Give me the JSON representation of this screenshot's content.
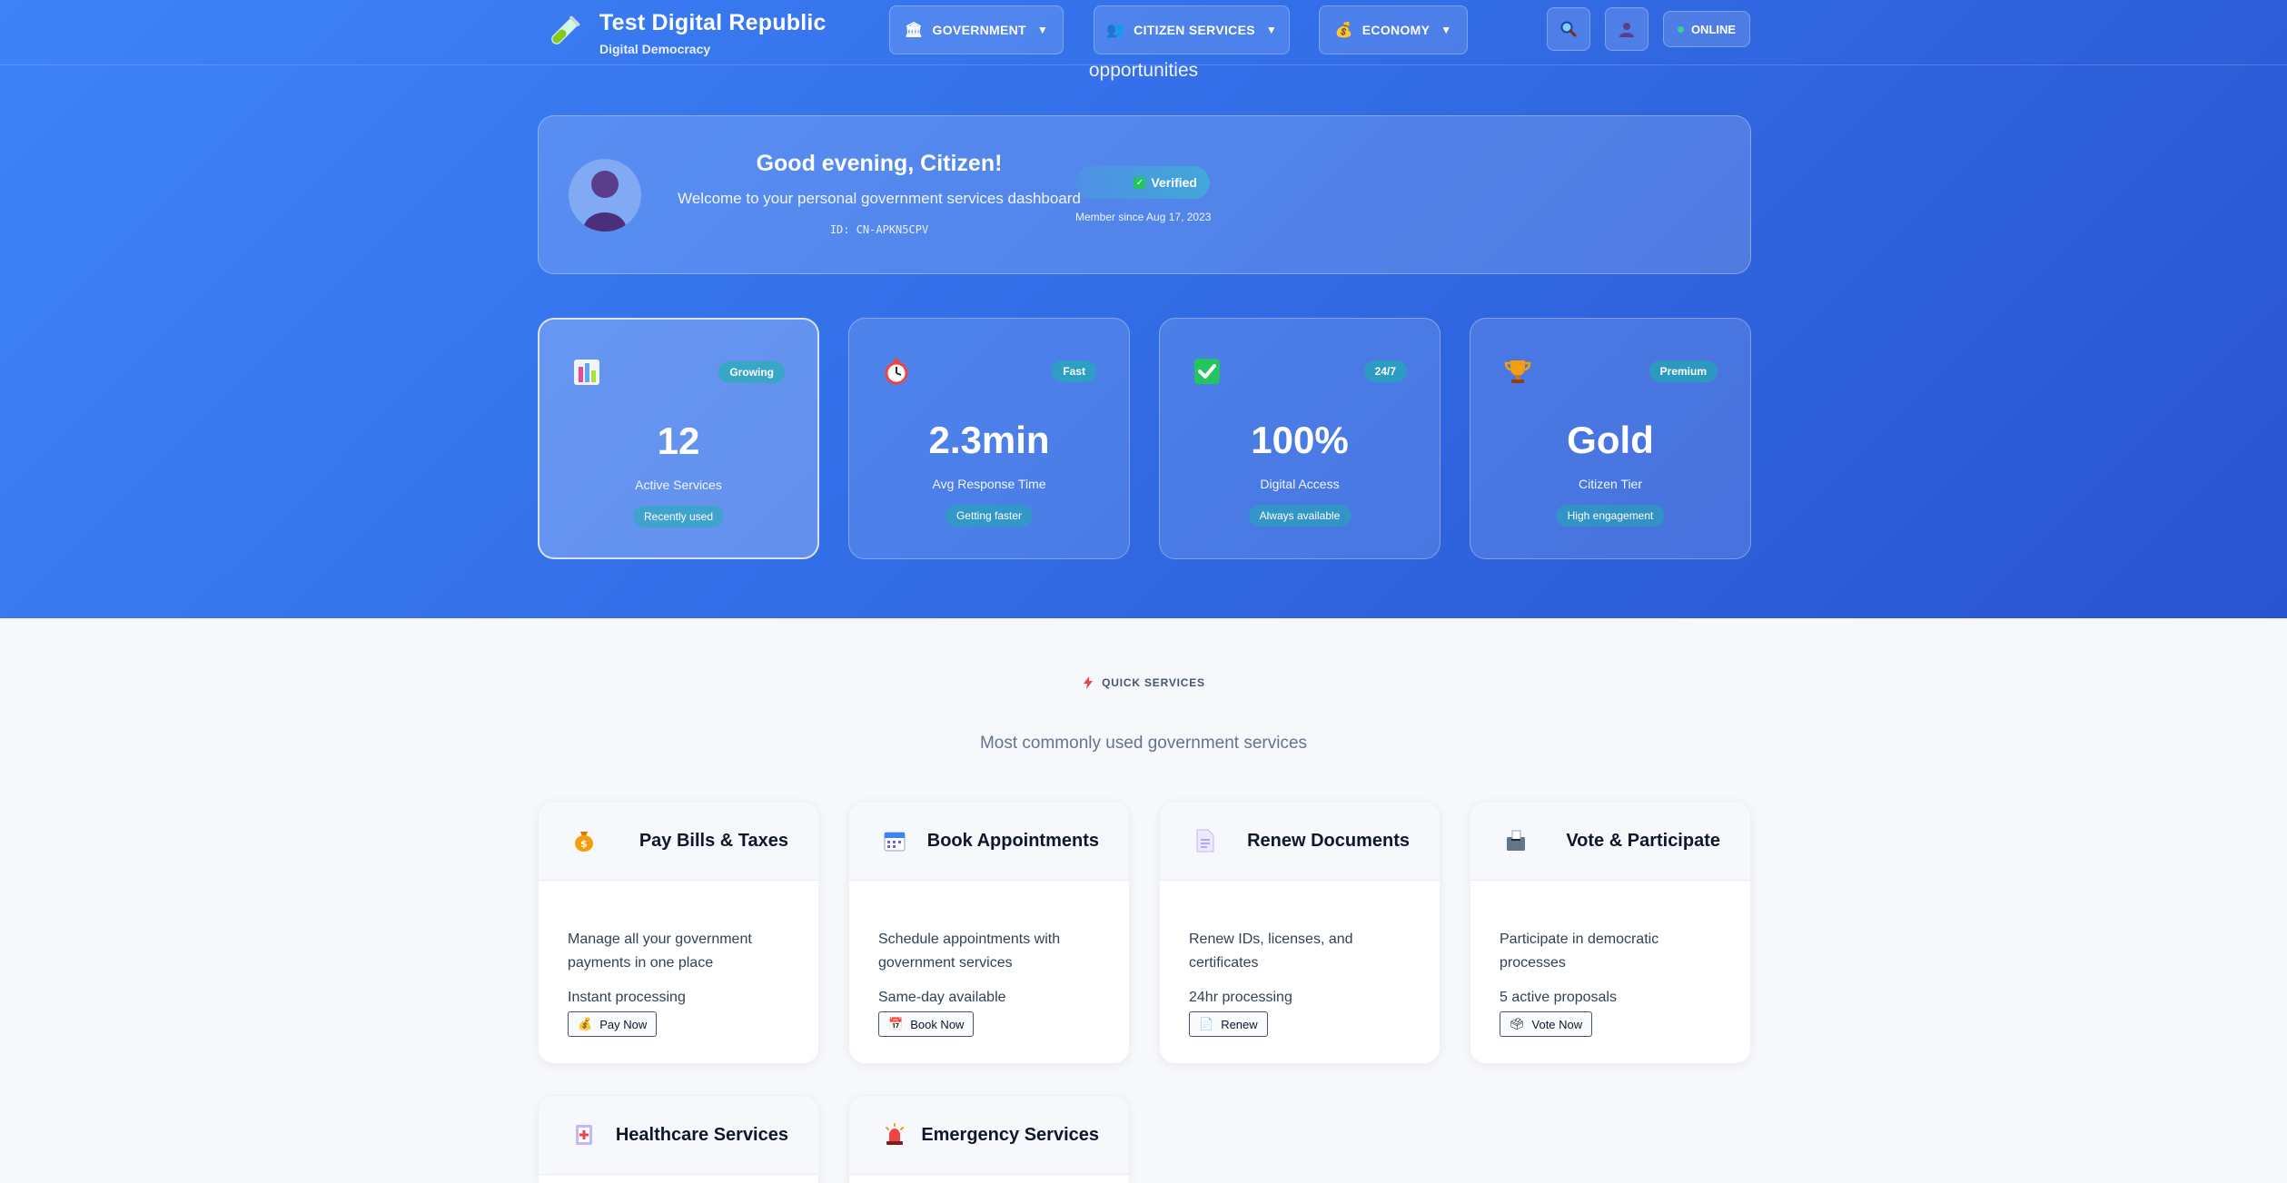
{
  "brand": {
    "title": "Test Digital Republic",
    "subtitle": "Digital Democracy",
    "icon": "test-tube-icon"
  },
  "nav": [
    {
      "label": "GOVERNMENT",
      "icon": "classical-building-icon"
    },
    {
      "label": "CITIZEN SERVICES",
      "icon": "people-icon"
    },
    {
      "label": "ECONOMY",
      "icon": "money-bag-icon"
    }
  ],
  "nav_icons": [
    "search-icon",
    "user-icon"
  ],
  "status": {
    "label": "ONLINE",
    "color": "#34d399"
  },
  "hero_cut_text": "opportunities",
  "welcome": {
    "greeting": "Good evening, Citizen!",
    "subtitle": "Welcome to your personal government services dashboard",
    "citizen_id": "ID: CN-APKN5CPV",
    "verified": "Verified",
    "member_since": "Member since Aug 17, 2023"
  },
  "stats": [
    {
      "icon": "bar-chart-icon",
      "badge": "Growing",
      "value": "12",
      "label": "Active Services",
      "footer": "Recently used",
      "active": true
    },
    {
      "icon": "stopwatch-icon",
      "badge": "Fast",
      "value": "2.3min",
      "label": "Avg Response Time",
      "footer": "Getting faster",
      "active": false
    },
    {
      "icon": "check-mark-icon",
      "badge": "24/7",
      "value": "100%",
      "label": "Digital Access",
      "footer": "Always available",
      "active": false
    },
    {
      "icon": "trophy-icon",
      "badge": "Premium",
      "value": "Gold",
      "label": "Citizen Tier",
      "footer": "High engagement",
      "active": false
    }
  ],
  "quick_services": {
    "heading": "QUICK SERVICES",
    "heading_icon": "lightning-icon",
    "subtitle": "Most commonly used government services",
    "cards": [
      {
        "title": "Pay Bills & Taxes",
        "icon": "money-bag-icon",
        "description": "Manage all your government payments in one place",
        "meta": "Instant processing",
        "button": "Pay Now"
      },
      {
        "title": "Book Appointments",
        "icon": "calendar-icon",
        "description": "Schedule appointments with government services",
        "meta": "Same-day available",
        "button": "Book Now"
      },
      {
        "title": "Renew Documents",
        "icon": "document-icon",
        "description": "Renew IDs, licenses, and certificates",
        "meta": "24hr processing",
        "button": "Renew"
      },
      {
        "title": "Vote & Participate",
        "icon": "ballot-box-icon",
        "description": "Participate in democratic processes",
        "meta": "5 active proposals",
        "button": "Vote Now"
      },
      {
        "title": "Healthcare Services",
        "icon": "medical-icon"
      },
      {
        "title": "Emergency Services",
        "icon": "siren-icon"
      }
    ]
  }
}
